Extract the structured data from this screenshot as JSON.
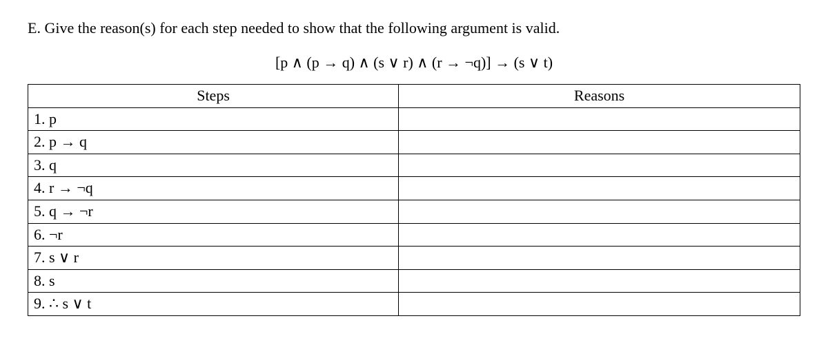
{
  "prompt": "E. Give the reason(s) for each step needed to show that the following argument is valid.",
  "formula": "[p ∧ (p → q) ∧ (s ∨ r) ∧ (r → ¬q)] → (s ∨ t)",
  "headers": {
    "steps": "Steps",
    "reasons": "Reasons"
  },
  "rows": [
    {
      "step": "1. p",
      "reason": ""
    },
    {
      "step": "2. p → q",
      "reason": ""
    },
    {
      "step": "3. q",
      "reason": ""
    },
    {
      "step": "4. r → ¬q",
      "reason": ""
    },
    {
      "step": "5. q → ¬r",
      "reason": ""
    },
    {
      "step": "6. ¬r",
      "reason": ""
    },
    {
      "step": "7. s ∨ r",
      "reason": ""
    },
    {
      "step": "8. s",
      "reason": ""
    },
    {
      "step": "9. ∴ s ∨ t",
      "reason": ""
    }
  ]
}
